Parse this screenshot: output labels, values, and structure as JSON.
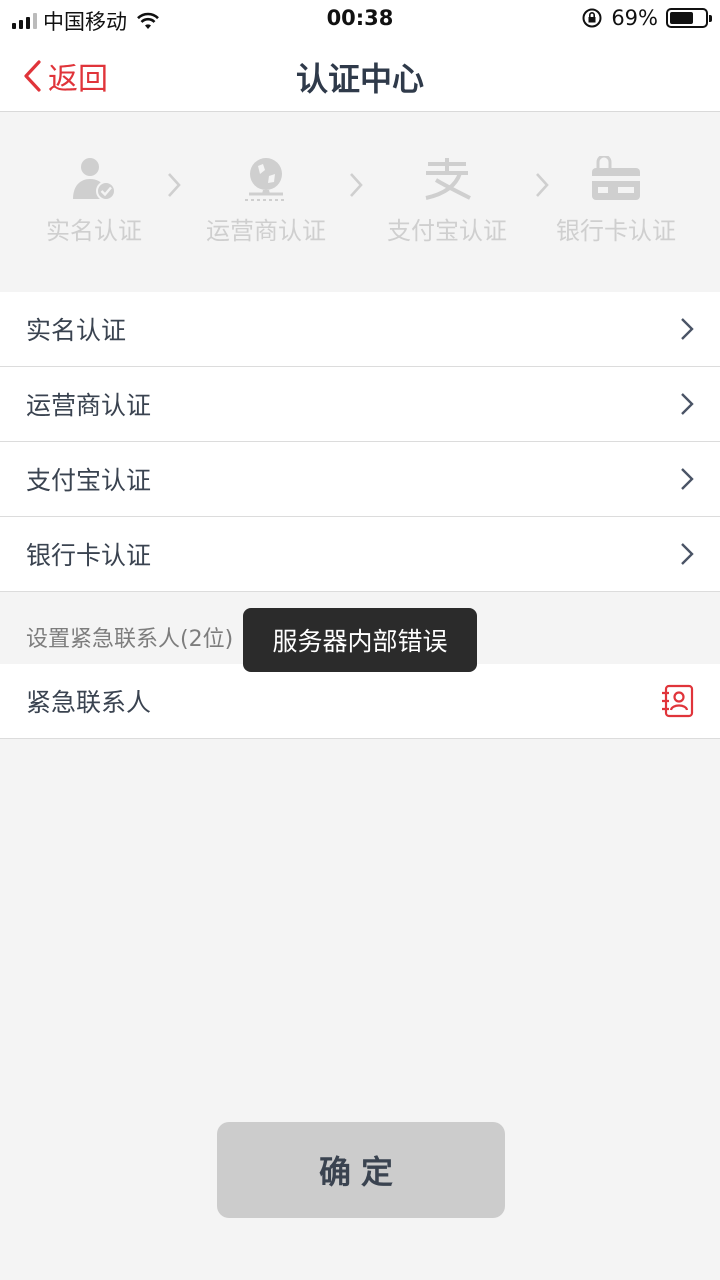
{
  "status_bar": {
    "carrier": "中国移动",
    "time": "00:38",
    "battery_percent": "69%",
    "battery_level": 0.69
  },
  "nav": {
    "back_label": "返回",
    "title": "认证中心"
  },
  "steps": [
    {
      "label": "实名认证",
      "icon": "user-verified-icon"
    },
    {
      "label": "运营商认证",
      "icon": "operator-globe-icon"
    },
    {
      "label": "支付宝认证",
      "icon": "alipay-icon"
    },
    {
      "label": "银行卡认证",
      "icon": "bank-card-icon"
    }
  ],
  "verification_list": [
    {
      "label": "实名认证"
    },
    {
      "label": "运营商认证"
    },
    {
      "label": "支付宝认证"
    },
    {
      "label": "银行卡认证"
    }
  ],
  "emergency": {
    "section_label": "设置紧急联系人(2位)",
    "row_label": "紧急联系人"
  },
  "toast": {
    "message": "服务器内部错误"
  },
  "confirm_button": {
    "label": "确定"
  },
  "colors": {
    "accent": "#e0343a",
    "disabled_button": "#cccccc",
    "background": "#f4f4f4"
  }
}
